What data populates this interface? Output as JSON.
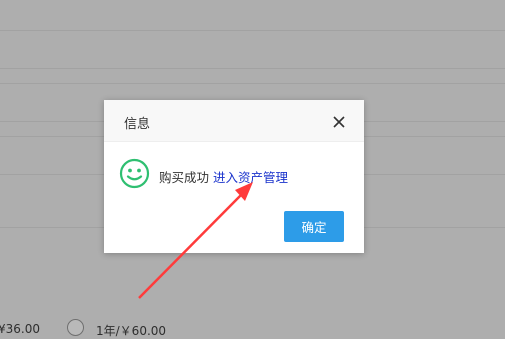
{
  "background": {
    "price_left": "¥36.00",
    "price_right": "1年/￥60.00"
  },
  "dialog": {
    "title": "信息",
    "message": "购买成功",
    "link": "进入资产管理",
    "ok_label": "确定",
    "icon": "smile-icon",
    "close_icon": "close-icon"
  },
  "colors": {
    "overlay": "#aeaeae",
    "accent": "#2d9ce8",
    "link": "#1a33cc",
    "success": "#2fbf71",
    "annotation": "#ff3b3b"
  }
}
